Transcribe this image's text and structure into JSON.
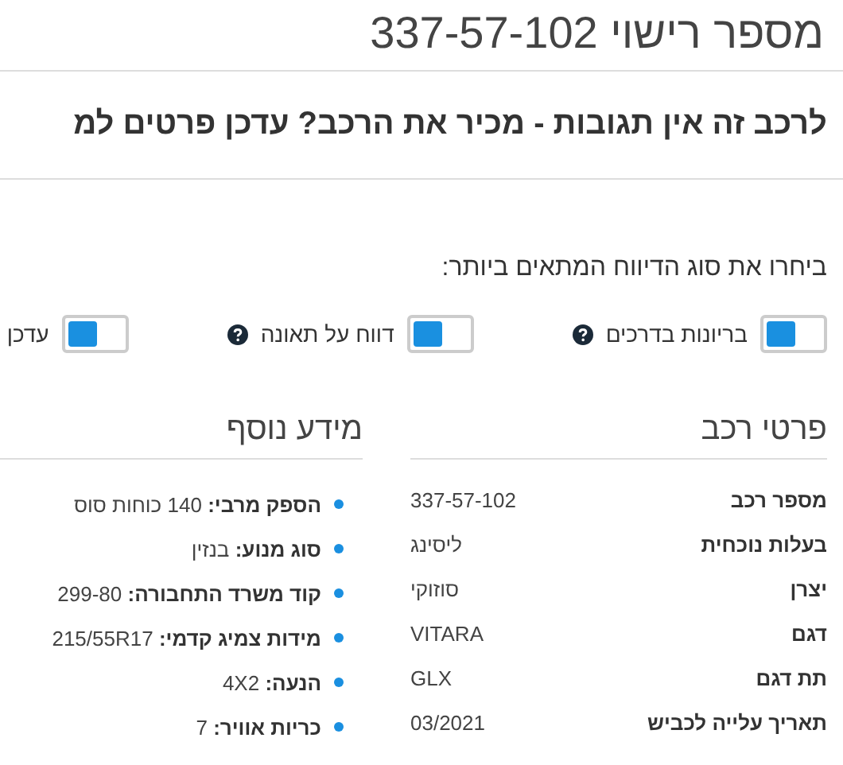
{
  "page": {
    "title": "מספר רישוי 337-57-102",
    "notice": "לרכב זה אין תגובות - מכיר את הרכב? עדכן פרטים למ"
  },
  "report": {
    "prompt": "ביחרו את סוג הדיווח המתאים ביותר:",
    "options": [
      {
        "label": "בריונות בדרכים",
        "on": false,
        "help": true
      },
      {
        "label": "דווח על תאונה",
        "on": false,
        "help": true
      },
      {
        "label": "עדכן",
        "on": false,
        "help": false
      }
    ]
  },
  "vehicle": {
    "heading": "פרטי רכב",
    "rows": [
      {
        "label": "מספר רכב",
        "value": "337-57-102"
      },
      {
        "label": "בעלות נוכחית",
        "value": "ליסינג"
      },
      {
        "label": "יצרן",
        "value": "סוזוקי"
      },
      {
        "label": "דגם",
        "value": "VITARA"
      },
      {
        "label": "תת דגם",
        "value": "GLX"
      },
      {
        "label": "תאריך עלייה לכביש",
        "value": "03/2021"
      }
    ]
  },
  "extra": {
    "heading": "מידע נוסף",
    "items": [
      {
        "label": "הספק מרבי:",
        "value": "140 כוחות סוס"
      },
      {
        "label": "סוג מנוע:",
        "value": "בנזין"
      },
      {
        "label": "קוד משרד התחבורה:",
        "value": "299-80"
      },
      {
        "label": "מידות צמיג קדמי:",
        "value": "215/55R17"
      },
      {
        "label": "הנעה:",
        "value": "4X2"
      },
      {
        "label": "כריות אוויר:",
        "value": "7"
      }
    ]
  }
}
